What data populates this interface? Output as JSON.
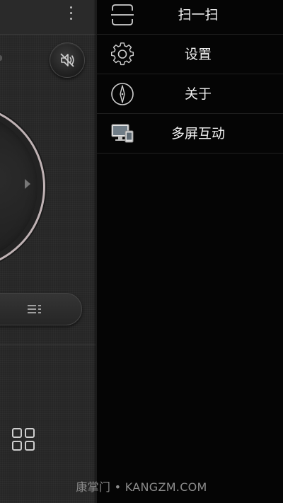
{
  "remote": {
    "overflow_menu_icon": "more-vertical-icon",
    "mute_icon": "speaker-muted-icon",
    "menu_icon": "menu-lines-icon",
    "apps_icon": "apps-grid-icon",
    "dpad_direction": "right-arrow"
  },
  "drawer": {
    "items": [
      {
        "label": "扫一扫",
        "icon": "scan-icon"
      },
      {
        "label": "设置",
        "icon": "gear-icon"
      },
      {
        "label": "关于",
        "icon": "compass-icon"
      },
      {
        "label": "多屏互动",
        "icon": "multiscreen-icon"
      }
    ]
  },
  "watermark": "康掌门 • KANGZM.COM",
  "colors": {
    "drawer_background": "#050505",
    "panel_background": "#262626",
    "ring_color": "#bfb2b4",
    "text": "#f2f2f2"
  }
}
